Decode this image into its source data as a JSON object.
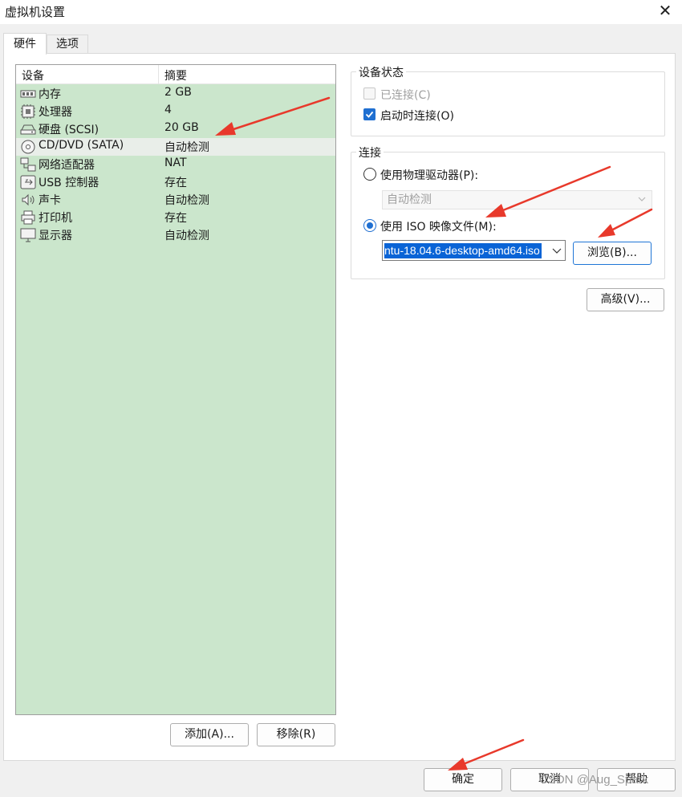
{
  "window": {
    "title": "虚拟机设置",
    "close_glyph": "✕"
  },
  "tabs": [
    {
      "label": "硬件",
      "active": true
    },
    {
      "label": "选项",
      "active": false
    }
  ],
  "device_list": {
    "columns": [
      "设备",
      "摘要"
    ],
    "rows": [
      {
        "icon": "memory-icon",
        "name": "内存",
        "summary": "2 GB"
      },
      {
        "icon": "processor-icon",
        "name": "处理器",
        "summary": "4"
      },
      {
        "icon": "harddisk-icon",
        "name": "硬盘 (SCSI)",
        "summary": "20 GB"
      },
      {
        "icon": "cd-dvd-icon",
        "name": "CD/DVD (SATA)",
        "summary": "自动检测",
        "selected": true
      },
      {
        "icon": "network-adapter-icon",
        "name": "网络适配器",
        "summary": "NAT"
      },
      {
        "icon": "usb-icon",
        "name": "USB 控制器",
        "summary": "存在"
      },
      {
        "icon": "sound-card-icon",
        "name": "声卡",
        "summary": "自动检测"
      },
      {
        "icon": "printer-icon",
        "name": "打印机",
        "summary": "存在"
      },
      {
        "icon": "display-icon",
        "name": "显示器",
        "summary": "自动检测"
      }
    ]
  },
  "list_buttons": {
    "add": "添加(A)...",
    "remove": "移除(R)"
  },
  "device_status": {
    "title": "设备状态",
    "connected": {
      "label": "已连接(C)",
      "checked": false,
      "disabled": true
    },
    "connect_at_power_on": {
      "label": "启动时连接(O)",
      "checked": true
    }
  },
  "connection": {
    "title": "连接",
    "physical_drive": {
      "label": "使用物理驱动器(P):",
      "selected": false,
      "dropdown_value": "自动检测"
    },
    "iso_image": {
      "label": "使用 ISO 映像文件(M):",
      "selected": true,
      "path_value": "ntu-18.04.6-desktop-amd64.iso"
    },
    "browse_button": "浏览(B)..."
  },
  "advanced_button": "高级(V)...",
  "footer_buttons": {
    "ok": "确定",
    "cancel": "取消",
    "help": "帮助"
  },
  "watermark": "CSDN @Aug_Spark",
  "colors": {
    "list_background": "#cbe6cc",
    "accent": "#1f6fd1",
    "annotation_arrow": "#e8392b"
  }
}
